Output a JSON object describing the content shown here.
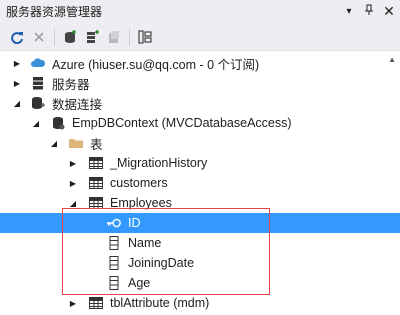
{
  "window": {
    "title": "服务器资源管理器",
    "pin_glyph": "▾",
    "autohide_glyph": "⊣",
    "close_glyph": "✕"
  },
  "toolbar": {
    "buttons": [
      {
        "name": "refresh-icon"
      },
      {
        "name": "stop-icon"
      },
      {
        "name": "connect-database-icon"
      },
      {
        "name": "connect-server-icon"
      },
      {
        "name": "connect-sharepoint-icon"
      },
      {
        "name": "properties-icon"
      }
    ]
  },
  "tree": {
    "azure": "Azure (hiuser.su@qq.com - 0 个订阅)",
    "servers": "服务器",
    "data_connections": "数据连接",
    "context": "EmpDBContext (MVCDatabaseAccess)",
    "tables_folder": "表",
    "migration_history": "_MigrationHistory",
    "customers": "customers",
    "employees": "Employees",
    "col_id": "ID",
    "col_name": "Name",
    "col_joining_date": "JoiningDate",
    "col_age": "Age",
    "tbl_attribute": "tblAttribute (mdm)"
  },
  "colors": {
    "selection": "#3399ff",
    "highlight_box": "#e8434a",
    "chrome": "#eeeef2"
  }
}
